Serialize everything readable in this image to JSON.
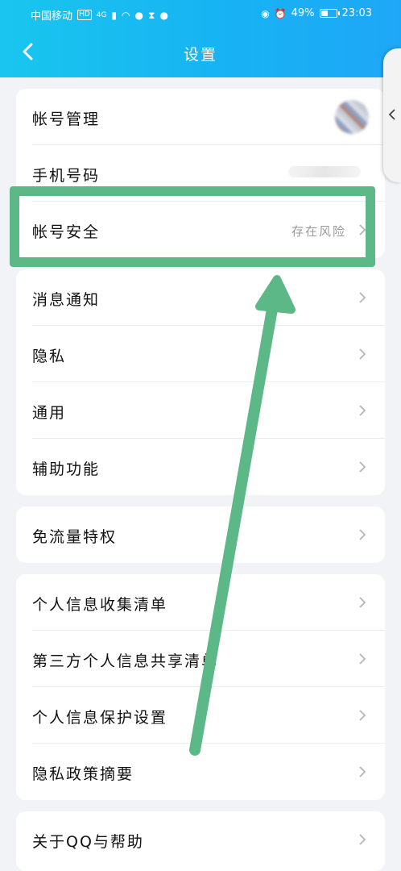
{
  "status_bar": {
    "carrier": "中国移动",
    "hd_badge": "HD",
    "network": "4G",
    "battery": "49%",
    "battery_level": 0.49,
    "time": "23:03"
  },
  "header": {
    "title": "设置"
  },
  "groups": [
    {
      "items": [
        {
          "label": "帐号管理"
        },
        {
          "label": "手机号码"
        },
        {
          "label": "帐号安全",
          "value": "存在风险"
        }
      ]
    },
    {
      "items": [
        {
          "label": "消息通知"
        },
        {
          "label": "隐私"
        },
        {
          "label": "通用"
        },
        {
          "label": "辅助功能"
        }
      ]
    },
    {
      "items": [
        {
          "label": "免流量特权"
        }
      ]
    },
    {
      "items": [
        {
          "label": "个人信息收集清单"
        },
        {
          "label": "第三方个人信息共享清单"
        },
        {
          "label": "个人信息保护设置"
        },
        {
          "label": "隐私政策摘要"
        }
      ]
    },
    {
      "items": [
        {
          "label": "关于QQ与帮助"
        }
      ]
    }
  ],
  "annotation": {
    "color": "#5cb887"
  },
  "colors": {
    "header": "#17b3f3",
    "background": "#f2f3f7",
    "highlight": "#5cb887"
  }
}
